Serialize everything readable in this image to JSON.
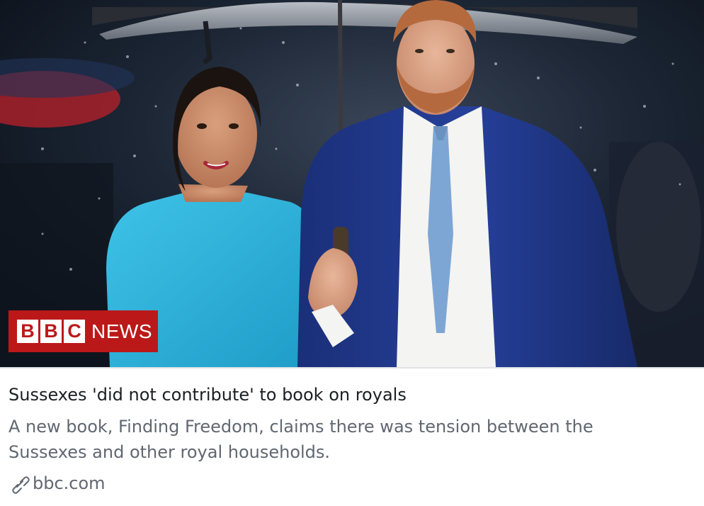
{
  "preview": {
    "image_alt": "Meghan and Harry walking under an umbrella in the rain",
    "logo": {
      "letters": [
        "B",
        "B",
        "C"
      ],
      "label": "NEWS",
      "color": "#bb1919"
    },
    "headline": "Sussexes 'did not contribute' to book on royals",
    "description_line1": "A new book, Finding Freedom, claims there was tension between the",
    "description_line2": "Sussexes and other royal households.",
    "source": "bbc.com",
    "source_icon": "link-icon"
  }
}
